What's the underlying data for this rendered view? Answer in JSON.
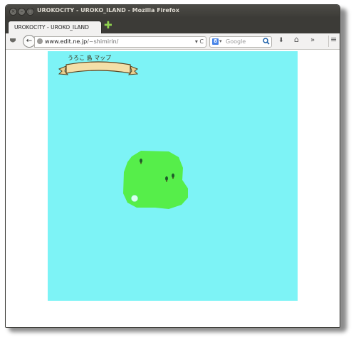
{
  "window": {
    "title": "UROKOCITY - UROKO_ILAND - Mozilla Firefox",
    "buttons": [
      "close",
      "minimize",
      "maximize"
    ]
  },
  "tabs": [
    {
      "label": "UROKOCITY - UROKO_ILAND",
      "active": true
    }
  ],
  "newtab_symbol": "✚",
  "navbar": {
    "back_symbol": "←",
    "url_domain": "www.edit.ne.jp",
    "url_path": "/~shimirin/",
    "url_controls": "▾ C",
    "search_engine_symbol": "8",
    "search_engine_caret": "▾",
    "search_placeholder": "Google",
    "search_symbol": "🔍",
    "download_symbol": "⬇",
    "home_symbol": "⌂",
    "more_symbol": "»",
    "menu_symbol": "≡"
  },
  "map": {
    "banner_text": "うろこ 島 マップ",
    "colors": {
      "sea": "#7df3f6",
      "land": "#56ee4a",
      "banner": "#f4dfa8"
    }
  }
}
